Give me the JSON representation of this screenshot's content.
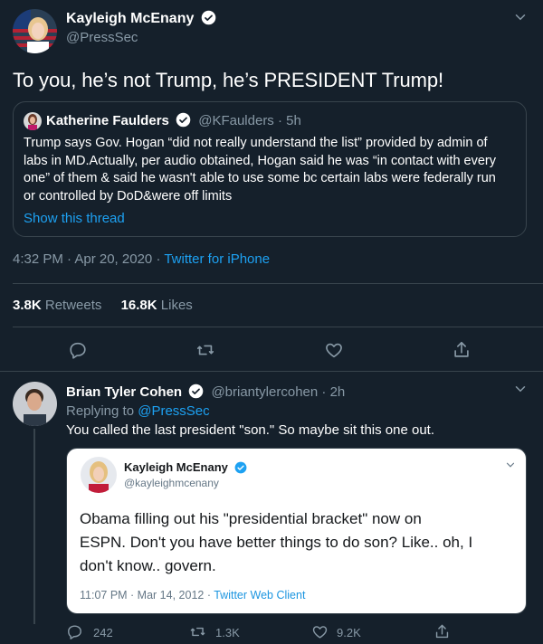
{
  "main_tweet": {
    "author_name": "Kayleigh McEnany",
    "author_handle": "@PressSec",
    "text": "To you, he’s not Trump, he’s PRESIDENT Trump!",
    "timestamp": "4:32 PM · Apr 20, 2020",
    "separator": "·",
    "source": "Twitter for iPhone",
    "retweets_count": "3.8K",
    "retweets_label": "Retweets",
    "likes_count": "16.8K",
    "likes_label": "Likes"
  },
  "quoted_tweet": {
    "author_name": "Katherine Faulders",
    "author_handle": "@KFaulders",
    "time": "· 5h",
    "lines": [
      "Trump says Gov. Hogan “did not really understand the list” provided by admin of",
      "labs in MD.Actually, per audio obtained, Hogan said he was “in contact with every",
      "one” of them & said he wasn't able to use some bc certain labs were federally run",
      "or controlled by DoD&were off limits"
    ],
    "show_thread": "Show this thread"
  },
  "reply_tweet": {
    "author_name": "Brian Tyler Cohen",
    "author_handle": "@briantylercohen",
    "time": "· 2h",
    "replying_to_prefix": "Replying to",
    "replying_to_handle": "@PressSec",
    "text": "You called the last president \"son.\" So maybe sit this one out.",
    "reply_count": "242",
    "retweet_count": "1.3K",
    "like_count": "9.2K"
  },
  "embedded_screenshot": {
    "author_name": "Kayleigh McEnany",
    "author_handle": "@kayleighmcenany",
    "lines": [
      "Obama filling out his \"presidential bracket\" now on",
      "ESPN.  Don't you have better things to do son? Like.. oh, I",
      "don't know.. govern."
    ],
    "timestamp": "11:07 PM · Mar 14, 2012 ·",
    "source": "Twitter Web Client"
  },
  "icons": [
    "chevron-down-icon",
    "verified-badge-icon",
    "reply-icon",
    "retweet-icon",
    "like-icon",
    "share-icon"
  ],
  "colors": {
    "background": "#15202b",
    "accent": "#1da1f2",
    "muted": "#8899a6",
    "border": "#38444d"
  }
}
